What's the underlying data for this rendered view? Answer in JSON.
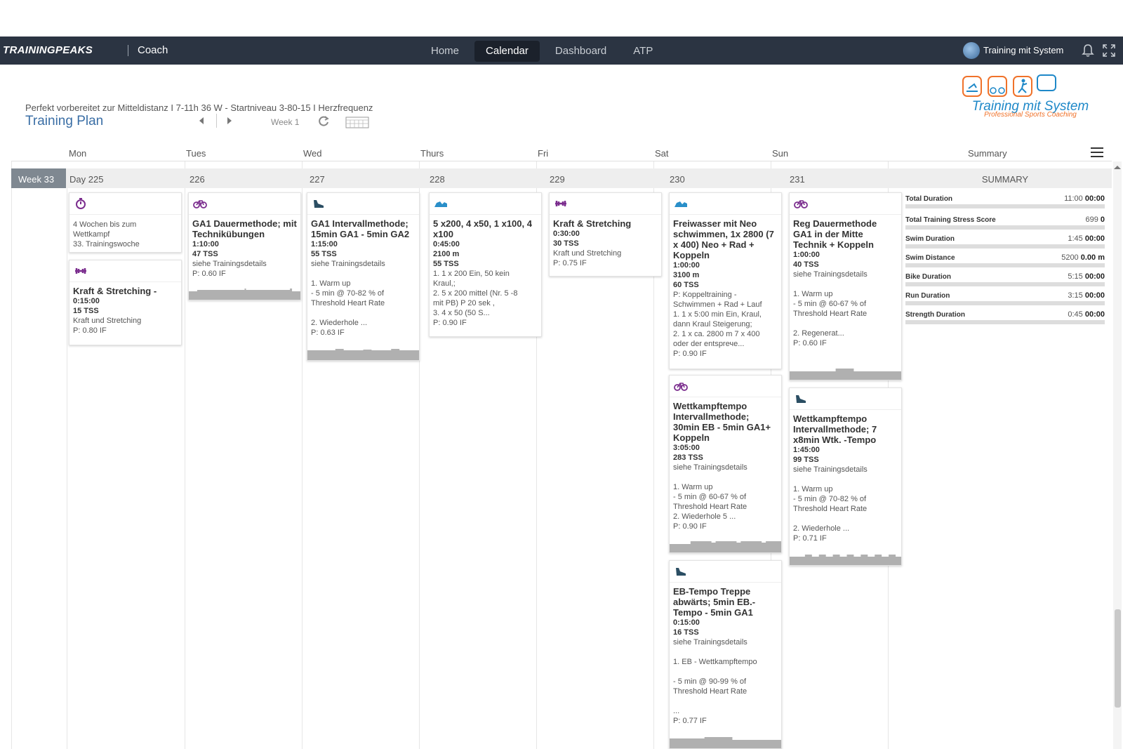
{
  "topbar": {
    "brand": "TRAININGPEAKS",
    "product": "Coach",
    "tabs": [
      {
        "label": "Home",
        "active": false
      },
      {
        "label": "Calendar",
        "active": true
      },
      {
        "label": "Dashboard",
        "active": false
      },
      {
        "label": "ATP",
        "active": false
      }
    ],
    "user_name": "Training mit System"
  },
  "plan": {
    "subtitle": "Perfekt vorbereitet zur Mitteldistanz I 7-11h 36 W - Startniveau 3-80-15 I Herzfrequenz",
    "title": "Training Plan",
    "week_label": "Week 1"
  },
  "logo": {
    "text": "Training mit System",
    "tagline": "Professional Sports Coaching"
  },
  "days": [
    "Mon",
    "Tues",
    "Wed",
    "Thurs",
    "Fri",
    "Sat",
    "Sun"
  ],
  "summary_header": "Summary",
  "week": {
    "badge": "Week 33",
    "day_numbers": [
      "Day 225",
      "226",
      "227",
      "228",
      "229",
      "230",
      "231"
    ]
  },
  "colors": {
    "strength": "#7b2d8e",
    "bike": "#7b2d8e",
    "run": "#2b4e63",
    "swim": "#2a8fc9",
    "topbar": "#2b3442"
  },
  "cards": {
    "mon1": {
      "icon": "stopwatch-icon",
      "lines": [
        "4 Wochen bis zum",
        "Wettkampf",
        "33. Trainingswoche"
      ]
    },
    "mon2": {
      "icon": "dumbbell-icon",
      "title": "Kraft & Stretching -",
      "duration": "0:15:00",
      "tss": "15 TSS",
      "desc": "Kraft und Stretching",
      "if": "P: 0.80 IF"
    },
    "tue1": {
      "icon": "bike-icon",
      "title": "GA1 Dauermethode; mit Technikübungen",
      "duration": "1:10:00",
      "tss": "47 TSS",
      "desc": "siehe Trainingsdetails",
      "if": "P: 0.60 IF"
    },
    "wed1": {
      "icon": "run-shoe-icon",
      "title": "GA1 Intervallmethode; 15min GA1 - 5min GA2",
      "duration": "1:15:00",
      "tss": "55 TSS",
      "desc": "siehe Trainingsdetails",
      "detail1": "1. Warm up\n- 5 min @ 70-82 % of\nThreshold Heart Rate",
      "detail2": "2. Wiederhole ...",
      "if": "P: 0.63 IF"
    },
    "thu1": {
      "icon": "swim-icon",
      "title": "5 x200, 4 x50, 1 x100, 4 x100",
      "duration": "0:45:00",
      "distance": "2100 m",
      "tss": "55 TSS",
      "detail1": "1. 1 x 200 Ein, 50 kein\nKraul,;\n2. 5 x 200 mittel (Nr. 5 -8\nmit PB) P 20 sek ,\n3. 4 x 50 (50 S...",
      "if": "P: 0.90 IF"
    },
    "fri1": {
      "icon": "dumbbell-icon",
      "title": "Kraft & Stretching",
      "duration": "0:30:00",
      "tss": "30 TSS",
      "desc": "Kraft und Stretching",
      "if": "P: 0.75 IF"
    },
    "sat1": {
      "icon": "swim-icon",
      "title": "Freiwasser mit Neo schwimmen, 1x 2800 (7 x 400) Neo + Rad + Koppeln",
      "duration": "1:00:00",
      "distance": "3100 m",
      "tss": "60 TSS",
      "detail1": "P: Koppeltraining -\nSchwimmen + Rad + Lauf\n1. 1 x 5:00 min Ein, Kraul,\ndann Kraul Steigerung;\n2. 1 x ca. 2800 m 7 x 400\noder der entsprече...",
      "if": "P: 0.90 IF"
    },
    "sat2": {
      "icon": "bike-icon",
      "title": "Wettkampftempo Intervallmethode; 30min EB - 5min GA1+ Koppeln",
      "duration": "3:05:00",
      "tss": "283 TSS",
      "desc": "siehe Trainingsdetails",
      "detail1": "1. Warm up\n- 5 min @ 60-67 % of\nThreshold Heart Rate\n2. Wiederhole 5 ...",
      "if": "P: 0.90 IF"
    },
    "sat3": {
      "icon": "run-shoe-icon",
      "title": "EB-Tempo Treppe abwärts; 5min EB.-Tempo - 5min GA1",
      "duration": "0:15:00",
      "tss": "16 TSS",
      "desc": "siehe Trainingsdetails",
      "detail1": "1. EB - Wettkampftempo",
      "detail2": "- 5 min @ 90-99 % of\nThreshold Heart Rate",
      "detail3": "...",
      "if": "P: 0.77 IF"
    },
    "sun1": {
      "icon": "bike-icon",
      "title": "Reg Dauermethode GA1 in der Mitte Technik + Koppeln",
      "duration": "1:00:00",
      "tss": "40 TSS",
      "desc": "siehe Trainingsdetails",
      "detail1": "1. Warm up\n- 5 min @ 60-67 % of\nThreshold Heart Rate",
      "detail2": "2. Regenerat...",
      "if": "P: 0.60 IF"
    },
    "sun2": {
      "icon": "run-shoe-icon",
      "title": "Wettkampftempo Intervallmethode; 7 x8min Wtk. -Tempo",
      "duration": "1:45:00",
      "tss": "99 TSS",
      "desc": "siehe Trainingsdetails",
      "detail1": "1. Warm up\n- 5 min @ 70-82 % of\nThreshold Heart Rate",
      "detail2": "2. Wiederhole ...",
      "if": "P: 0.71 IF"
    }
  },
  "summary": {
    "title": "SUMMARY",
    "rows": [
      {
        "label": "Total Duration",
        "planned": "11:00",
        "actual": "00:00"
      },
      {
        "label": "Total Training Stress Score",
        "planned": "699",
        "actual": "0"
      },
      {
        "label": "Swim Duration",
        "planned": "1:45",
        "actual": "00:00"
      },
      {
        "label": "Swim Distance",
        "planned": "5200",
        "actual": "0.00 m"
      },
      {
        "label": "Bike Duration",
        "planned": "5:15",
        "actual": "00:00"
      },
      {
        "label": "Run Duration",
        "planned": "3:15",
        "actual": "00:00"
      },
      {
        "label": "Strength Duration",
        "planned": "0:45",
        "actual": "00:00"
      }
    ]
  }
}
